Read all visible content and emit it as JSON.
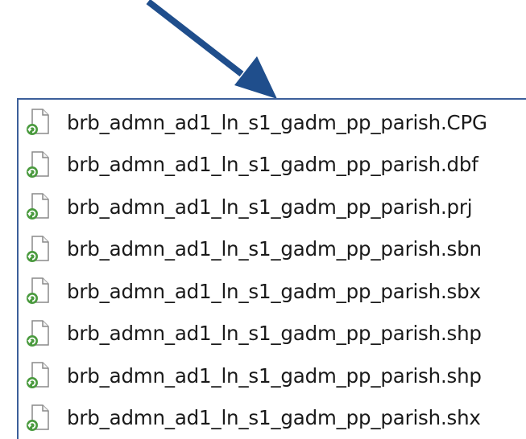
{
  "accent_color": "#1f4e8c",
  "file_list": {
    "items": [
      {
        "name": "brb_admn_ad1_ln_s1_gadm_pp_parish.CPG",
        "icon": "generic-file-icon"
      },
      {
        "name": "brb_admn_ad1_ln_s1_gadm_pp_parish.dbf",
        "icon": "generic-file-icon"
      },
      {
        "name": "brb_admn_ad1_ln_s1_gadm_pp_parish.prj",
        "icon": "generic-file-icon"
      },
      {
        "name": "brb_admn_ad1_ln_s1_gadm_pp_parish.sbn",
        "icon": "generic-file-icon"
      },
      {
        "name": "brb_admn_ad1_ln_s1_gadm_pp_parish.sbx",
        "icon": "generic-file-icon"
      },
      {
        "name": "brb_admn_ad1_ln_s1_gadm_pp_parish.shp",
        "icon": "generic-file-icon"
      },
      {
        "name": "brb_admn_ad1_ln_s1_gadm_pp_parish.shp",
        "icon": "generic-file-icon"
      },
      {
        "name": "brb_admn_ad1_ln_s1_gadm_pp_parish.shx",
        "icon": "generic-file-icon"
      }
    ]
  }
}
